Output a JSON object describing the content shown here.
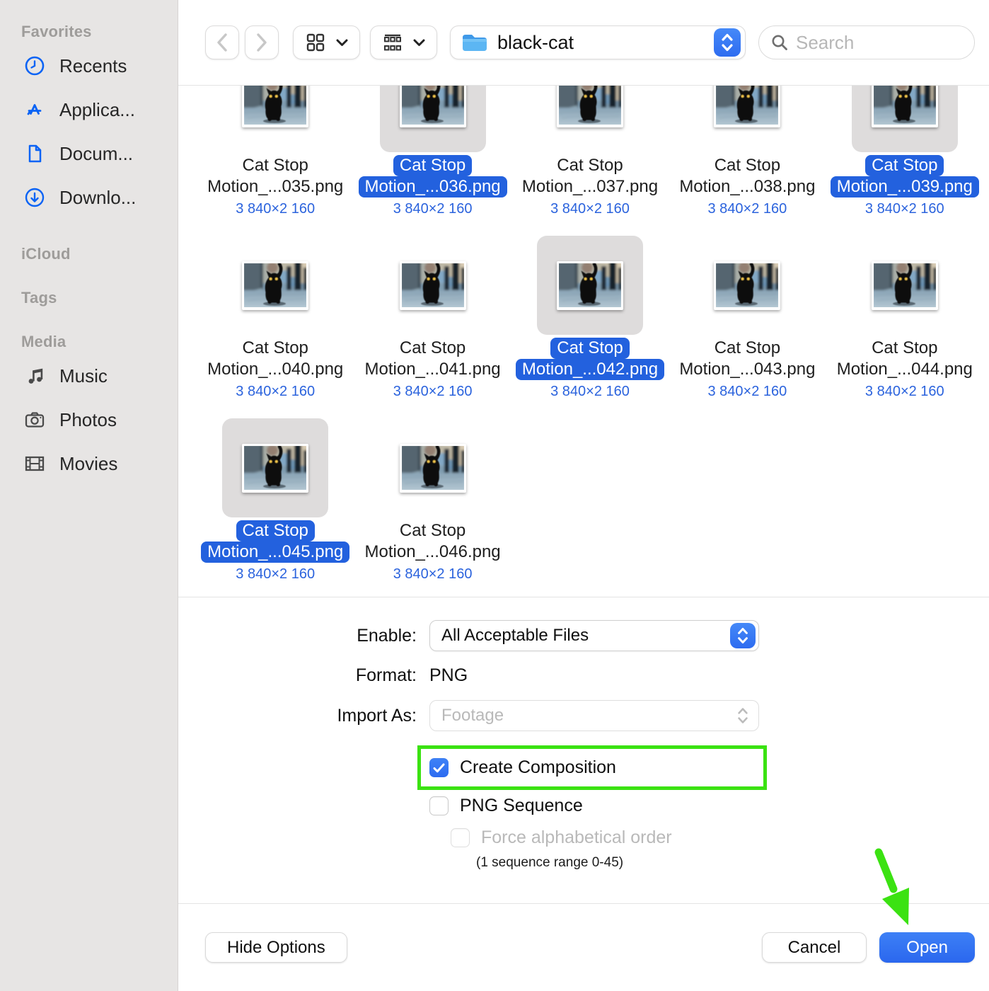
{
  "sidebar": {
    "sections": [
      {
        "title": "Favorites",
        "items": [
          {
            "label": "Recents",
            "icon": "clock-icon"
          },
          {
            "label": "Applica...",
            "icon": "appstore-icon"
          },
          {
            "label": "Docum...",
            "icon": "document-icon"
          },
          {
            "label": "Downlo...",
            "icon": "download-icon"
          }
        ]
      },
      {
        "title": "iCloud",
        "items": []
      },
      {
        "title": "Tags",
        "items": []
      },
      {
        "title": "Media",
        "items": [
          {
            "label": "Music",
            "icon": "music-icon"
          },
          {
            "label": "Photos",
            "icon": "camera-icon"
          },
          {
            "label": "Movies",
            "icon": "film-icon"
          }
        ]
      }
    ]
  },
  "toolbar": {
    "folder_name": "black-cat",
    "search_placeholder": "Search",
    "icons": [
      "back-chevron-icon",
      "forward-chevron-icon",
      "grid-view-icon",
      "group-view-icon",
      "chevron-down-icon",
      "folder-icon",
      "stepper-icon",
      "search-icon"
    ]
  },
  "files": {
    "name_line1": "Cat Stop",
    "dimensions": "3 840×2 160",
    "items": [
      {
        "name_line2": "Motion_...035.png",
        "selected": false,
        "row": 1
      },
      {
        "name_line2": "Motion_...036.png",
        "selected": true,
        "row": 1
      },
      {
        "name_line2": "Motion_...037.png",
        "selected": false,
        "row": 1
      },
      {
        "name_line2": "Motion_...038.png",
        "selected": false,
        "row": 1
      },
      {
        "name_line2": "Motion_...039.png",
        "selected": true,
        "row": 1
      },
      {
        "name_line2": "Motion_...040.png",
        "selected": false,
        "row": 2
      },
      {
        "name_line2": "Motion_...041.png",
        "selected": false,
        "row": 2
      },
      {
        "name_line2": "Motion_...042.png",
        "selected": true,
        "row": 2
      },
      {
        "name_line2": "Motion_...043.png",
        "selected": false,
        "row": 2
      },
      {
        "name_line2": "Motion_...044.png",
        "selected": false,
        "row": 2
      },
      {
        "name_line2": "Motion_...045.png",
        "selected": true,
        "row": 3
      },
      {
        "name_line2": "Motion_...046.png",
        "selected": false,
        "row": 3
      }
    ]
  },
  "form": {
    "enable_label": "Enable:",
    "enable_value": "All Acceptable Files",
    "format_label": "Format:",
    "format_value": "PNG",
    "import_label": "Import As:",
    "import_value": "Footage",
    "checkboxes": [
      {
        "label": "Create Composition",
        "checked": true,
        "disabled": false,
        "highlighted": true
      },
      {
        "label": "PNG Sequence",
        "checked": false,
        "disabled": false,
        "highlighted": false
      },
      {
        "label": "Force alphabetical order",
        "checked": false,
        "disabled": true,
        "highlighted": false
      }
    ],
    "sequence_note": "(1 sequence range 0-45)"
  },
  "footer": {
    "hide_options_label": "Hide Options",
    "cancel_label": "Cancel",
    "open_label": "Open"
  },
  "colors": {
    "accent_blue": "#2e6cf0",
    "selection_pill_blue": "#2361de",
    "dimension_text_blue": "#2b63dd",
    "annotation_green": "#3be212",
    "sidebar_bg": "#e7e5e4",
    "selected_icon_bg": "#dedcdc"
  }
}
